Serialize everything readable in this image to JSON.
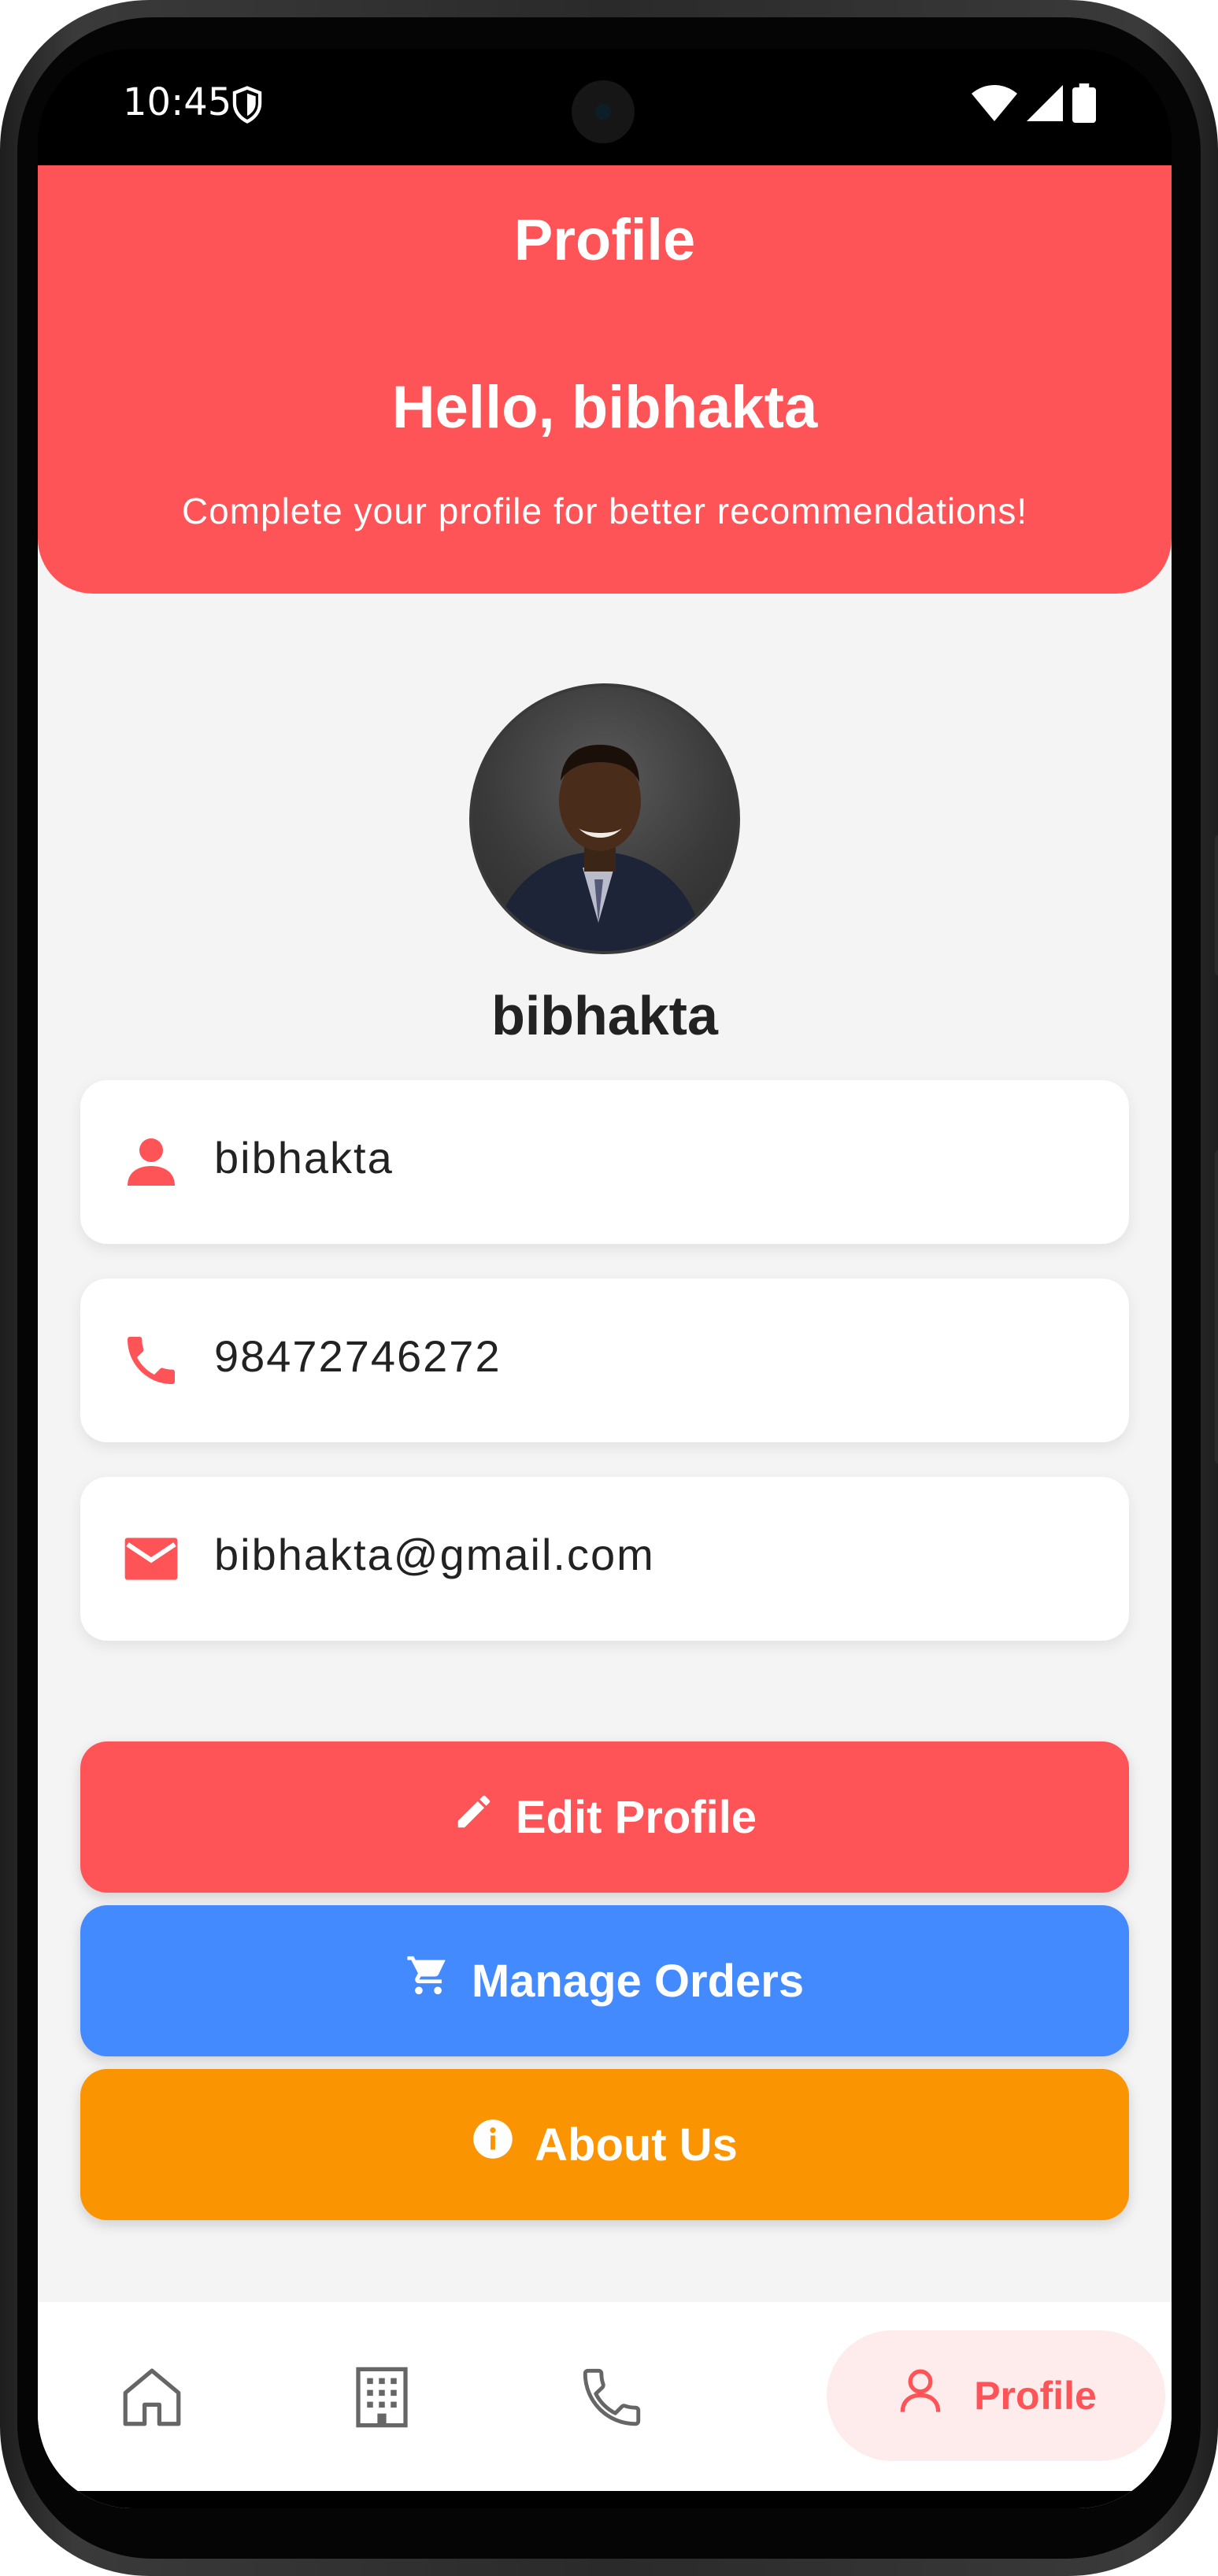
{
  "status_bar": {
    "time": "10:45",
    "icons": [
      "shield-icon",
      "wifi-icon",
      "signal-icon",
      "battery-icon"
    ]
  },
  "header": {
    "title": "Profile",
    "greeting": "Hello, bibhakta",
    "subtitle": "Complete your profile for better recommendations!"
  },
  "profile": {
    "display_name": "bibhakta",
    "avatar": "profile-photo"
  },
  "info": [
    {
      "icon": "person-icon",
      "value": "bibhakta"
    },
    {
      "icon": "phone-icon",
      "value": "98472746272"
    },
    {
      "icon": "email-icon",
      "value": "bibhakta@gmail.com"
    }
  ],
  "actions": [
    {
      "icon": "pencil-icon",
      "label": "Edit Profile",
      "color": "#fe5357"
    },
    {
      "icon": "cart-icon",
      "label": "Manage Orders",
      "color": "#448aff"
    },
    {
      "icon": "info-icon",
      "label": "About Us",
      "color": "#fb9401"
    }
  ],
  "bottom_nav": {
    "items": [
      {
        "icon": "home-icon"
      },
      {
        "icon": "building-icon"
      },
      {
        "icon": "phone-icon"
      },
      {
        "icon": "person-icon",
        "label": "Profile",
        "active": true
      }
    ]
  },
  "colors": {
    "accent": "#fe5357",
    "background": "#f4f4f4",
    "blue": "#448aff",
    "orange": "#fb9401"
  }
}
